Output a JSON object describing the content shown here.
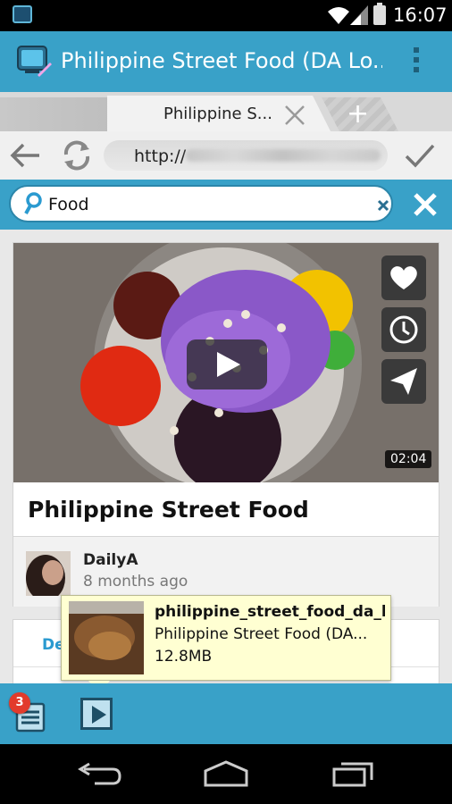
{
  "status_bar": {
    "time": "16:07"
  },
  "action_bar": {
    "title": "Philippine Street Food (DA Lo..."
  },
  "tabs": [
    {
      "label": "Philippine S...",
      "active": true
    }
  ],
  "address_bar": {
    "url": "http://"
  },
  "search": {
    "value": "Food",
    "placeholder": ""
  },
  "video": {
    "title": "Philippine Street Food",
    "duration": "02:04",
    "author": "DailyA",
    "posted": "8 months ago",
    "actions": [
      "heart-icon",
      "clock-icon",
      "send-icon"
    ]
  },
  "details_tab": {
    "label": "De"
  },
  "download_popup": {
    "filename": "philippine_street_food_da_l...",
    "title": "Philippine Street Food (DA...",
    "size": "12.8MB"
  },
  "bottom_bar": {
    "downloads_badge": "3"
  },
  "colors": {
    "accent": "#39a1c8",
    "badge": "#e23b2c",
    "popup_bg": "#ffffd2"
  }
}
